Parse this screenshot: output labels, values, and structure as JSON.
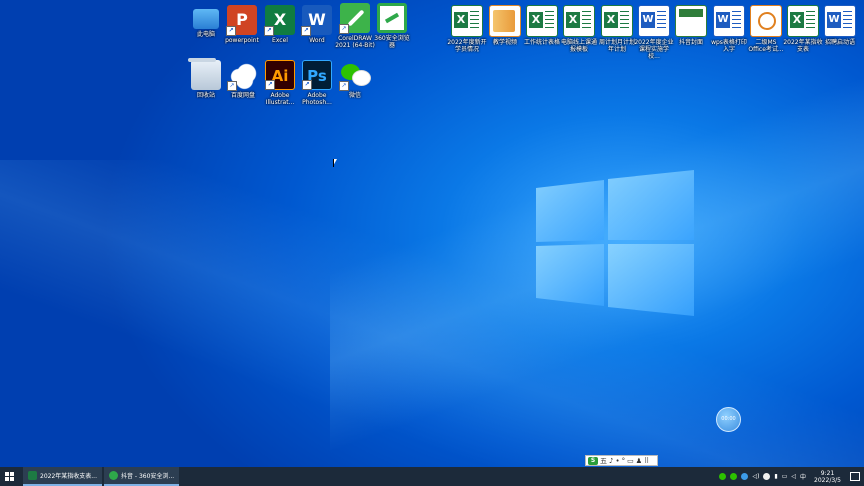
{
  "desktop_icons": [
    {
      "label": "此电脑"
    },
    {
      "label": "powerpoint"
    },
    {
      "label": "Excel"
    },
    {
      "label": "Word"
    },
    {
      "label": "CorelDRAW 2021 (64-Bit)"
    },
    {
      "label": "360安全浏览器"
    },
    {
      "label": "回收站"
    },
    {
      "label": "百度网盘"
    },
    {
      "label": "Adobe Illustrat..."
    },
    {
      "label": "Adobe Photosh..."
    },
    {
      "label": "微信"
    },
    {
      "label": "2022年度新开学员情况"
    },
    {
      "label": "教学视频"
    },
    {
      "label": "工作统计表格"
    },
    {
      "label": "电脑线上课通报模板"
    },
    {
      "label": "周计划月计划年计划"
    },
    {
      "label": "2022年度企业课程实施学校..."
    },
    {
      "label": "抖音封面"
    },
    {
      "label": "wps表格打印入字"
    },
    {
      "label": "二级MS Office考试..."
    },
    {
      "label": "2022年某指收支表"
    },
    {
      "label": "招聘启动语"
    }
  ],
  "icon_app_letters": {
    "ppt": "P",
    "excel": "X",
    "word": "W",
    "ai": "Ai",
    "ps": "Ps"
  },
  "float_ball": {
    "text": "00:00"
  },
  "ime_bar": {
    "logo": "S",
    "items": [
      "五",
      "♪",
      "•",
      "°",
      "▭",
      "♟",
      "⠿"
    ]
  },
  "taskbar": {
    "tasks": [
      {
        "label": "2022年某指收支表...",
        "color": "#1d7a43"
      },
      {
        "label": "抖音 - 360安全浏...",
        "color": "#2ea84a"
      }
    ],
    "tray": {
      "ime_label": "中",
      "time": "9:21",
      "date": "2022/3/5"
    }
  },
  "colors": {
    "taskbar": "#1c2a3a",
    "desktop": "#0a78e6"
  }
}
